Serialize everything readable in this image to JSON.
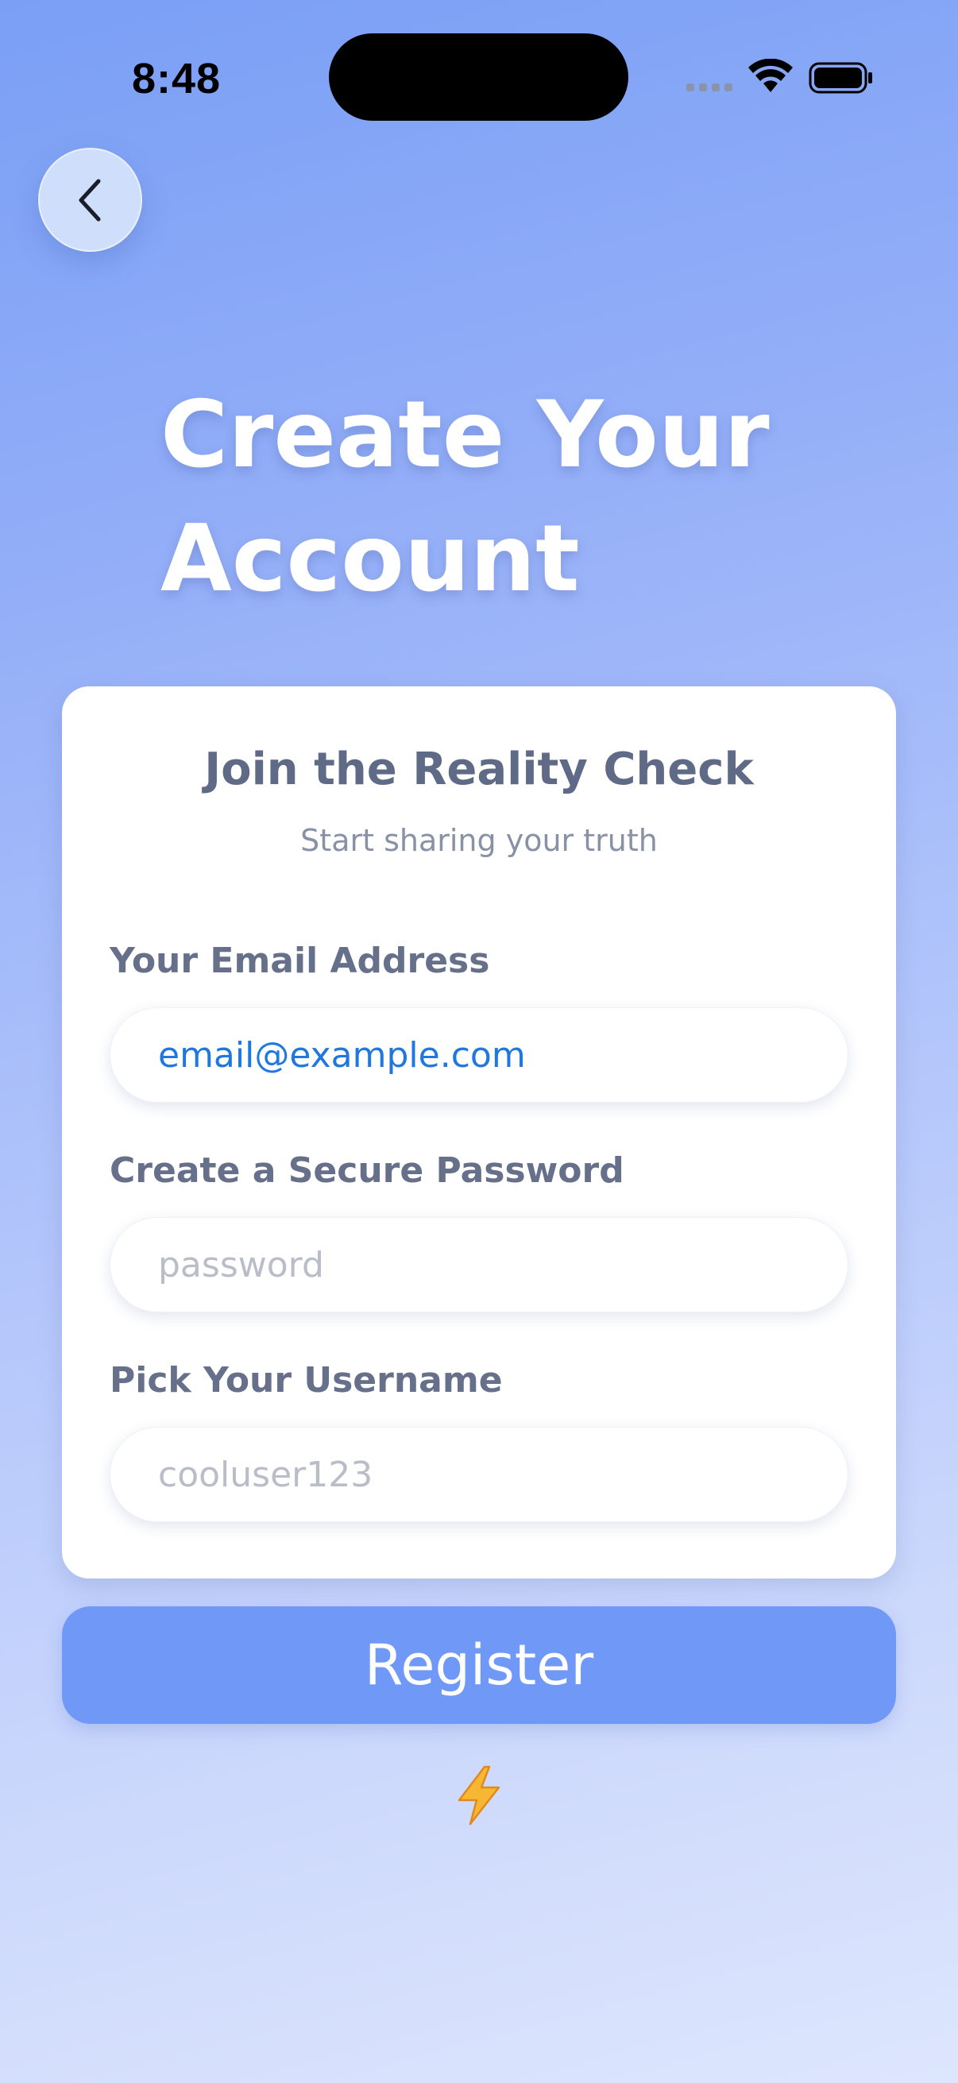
{
  "status_bar": {
    "time": "8:48"
  },
  "nav": {
    "back_icon": "chevron-left-icon"
  },
  "page": {
    "title_line1": "Create Your",
    "title_line2": "Account"
  },
  "card": {
    "title": "Join the Reality Check",
    "subtitle": "Start sharing your truth",
    "fields": [
      {
        "label": "Your Email Address",
        "value": "email@example.com",
        "placeholder": ""
      },
      {
        "label": "Create a Secure Password",
        "value": "",
        "placeholder": "password"
      },
      {
        "label": "Pick Your Username",
        "value": "",
        "placeholder": "cooluser123"
      }
    ]
  },
  "actions": {
    "register_label": "Register",
    "footer_icon": "lightning-icon"
  },
  "colors": {
    "accent": "#7098f6",
    "link": "#1f78e0",
    "label": "#66708a"
  }
}
